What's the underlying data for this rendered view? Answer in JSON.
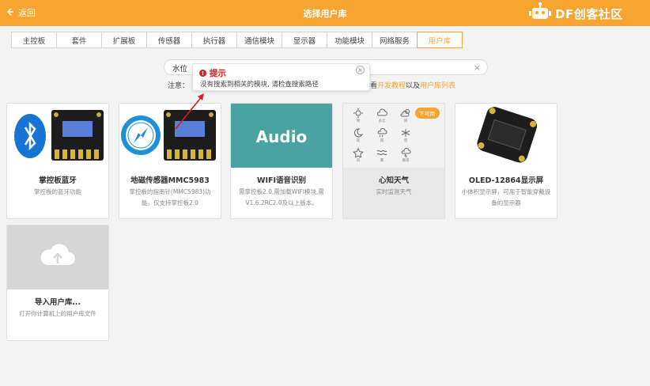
{
  "header": {
    "back_label": "返回",
    "title": "选择用户库",
    "brand": "DF创客社区"
  },
  "tabs": [
    {
      "label": "主控板",
      "active": false
    },
    {
      "label": "套件",
      "active": false
    },
    {
      "label": "扩展板",
      "active": false
    },
    {
      "label": "传感器",
      "active": false
    },
    {
      "label": "执行器",
      "active": false
    },
    {
      "label": "通信模块",
      "active": false
    },
    {
      "label": "显示器",
      "active": false
    },
    {
      "label": "功能模块",
      "active": false
    },
    {
      "label": "网络服务",
      "active": false
    },
    {
      "label": "用户库",
      "active": true
    }
  ],
  "search": {
    "value": "水位",
    "clear_glyph": "×"
  },
  "note": {
    "prefix": "注意：",
    "tail_text": "看",
    "link1": "开发教程",
    "middle": "以及",
    "link2": "用户库列表"
  },
  "tooltip": {
    "title": "提示",
    "message": "没有搜索到相关的模块, 请检查搜索路径",
    "close_glyph": "×"
  },
  "cards": [
    {
      "name": "掌控板蓝牙",
      "desc": "掌控板的蓝牙功能",
      "icon": "bluetooth-icon"
    },
    {
      "name": "地磁传感器MMC5983",
      "desc": "掌控板的指南针(MMC5983)功能，仅支持掌控板2.0",
      "icon": "compass-icon"
    },
    {
      "name": "WIFI语音识别",
      "desc": "需掌控板2.0,需加载WIFI模块,需V1.6.2RC2.0及以上版本。",
      "thumb_text": "Audio"
    },
    {
      "name": "心知天气",
      "desc": "实时监测天气",
      "badge": "不可用",
      "disabled": true,
      "weather_labels": [
        "晴",
        "多云",
        "阴",
        "夜",
        "雨",
        "雪",
        "风",
        "雾",
        "暴雨"
      ]
    },
    {
      "name": "OLED-12864显示屏",
      "desc": "小体积显示屏，可用于智能穿戴设备的显示器"
    },
    {
      "name": "导入用户库...",
      "desc": "打开你计算机上的用户库文件",
      "icon": "cloud-upload-icon"
    }
  ],
  "colors": {
    "accent": "#f7a530",
    "error": "#d81e1e",
    "audio_bg": "#4aa3a0"
  }
}
